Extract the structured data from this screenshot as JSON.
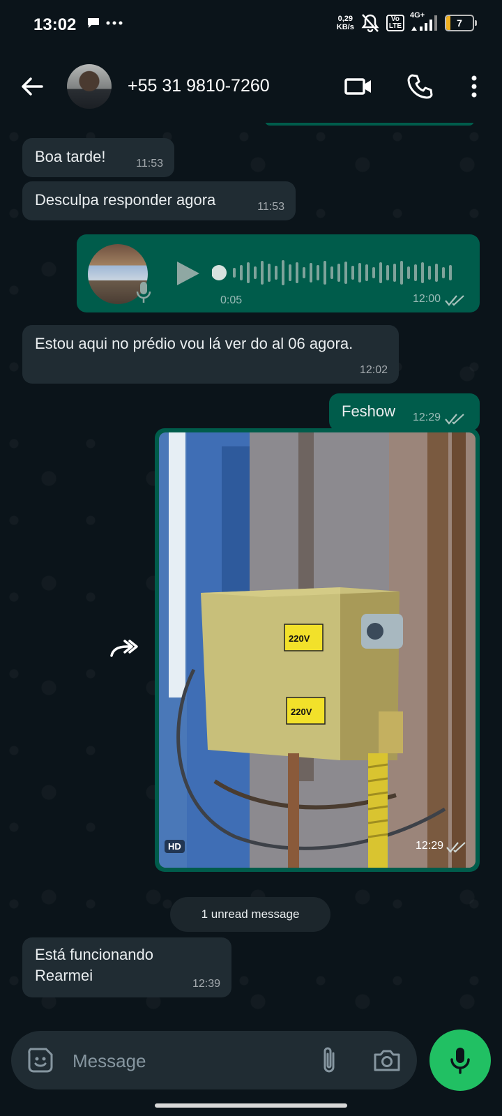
{
  "status_bar": {
    "time": "13:02",
    "net_speed_value": "0,29",
    "net_speed_unit": "KB/s",
    "volte_top": "Vo",
    "volte_bottom": "LTE",
    "network": "4G+",
    "battery": "7",
    "icons": [
      "chat-bubble-icon",
      "more-dots-icon",
      "mute-icon",
      "signal-icon"
    ]
  },
  "header": {
    "contact": "+55 31 9810-7260",
    "icons": [
      "back-arrow-icon",
      "video-call-icon",
      "phone-icon",
      "menu-icon"
    ]
  },
  "messages": [
    {
      "direction": "in",
      "text": "Boa tarde!",
      "time": "11:53"
    },
    {
      "direction": "in",
      "text": "Desculpa responder agora",
      "time": "11:53"
    },
    {
      "direction": "out",
      "type": "voice",
      "duration": "0:05",
      "time": "12:00",
      "status": "read"
    },
    {
      "direction": "in",
      "text": "Estou aqui no prédio vou lá ver do al 06 agora.",
      "time": "12:02"
    },
    {
      "direction": "out",
      "text": "Feshow",
      "time": "12:29",
      "status": "read"
    },
    {
      "direction": "out",
      "type": "image",
      "badge": "HD",
      "time": "12:29",
      "status": "read",
      "image_labels": [
        "220V",
        "220V"
      ]
    },
    {
      "direction": "in",
      "text": "Está funcionando\nRearmei",
      "time": "12:39"
    }
  ],
  "unread_divider": "1 unread message",
  "composer": {
    "placeholder": "Message",
    "icons": [
      "sticker-icon",
      "attach-icon",
      "camera-icon",
      "mic-icon"
    ]
  },
  "colors": {
    "background": "#0b141a",
    "incoming_bubble": "#202c33",
    "outgoing_bubble": "#005c4b",
    "mic_button": "#21c063"
  }
}
